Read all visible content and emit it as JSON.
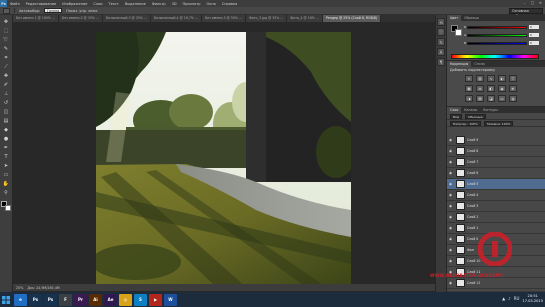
{
  "app": {
    "logo": "Ps"
  },
  "menu": [
    "Файл",
    "Редактирование",
    "Изображение",
    "Слои",
    "Текст",
    "Выделение",
    "Фильтр",
    "3D",
    "Просмотр",
    "Окно",
    "Справка"
  ],
  "window_controls": [
    "–",
    "□",
    "✕"
  ],
  "options": {
    "label_auto": "Автовыбор:",
    "auto_value": "Группа",
    "label_show": "Показ. упр. элем."
  },
  "workspace": "Основная рабочая среда",
  "doc_tabs": [
    {
      "label": "Без имени-1 @ 100% ...",
      "active": false
    },
    {
      "label": "Без имени-2 @ 33% ...",
      "active": false
    },
    {
      "label": "Безымянный-3 @ 25% ...",
      "active": false
    },
    {
      "label": "Безымянный-4 @ 16,7% ...",
      "active": false
    },
    {
      "label": "Без имени-5 @ 50% ...",
      "active": false
    },
    {
      "label": "Фото_3.jpg @ 33% ...",
      "active": false
    },
    {
      "label": "Фото_4 @ 16% ...",
      "active": false
    },
    {
      "label": "Рендер @ 25% (Слой 8, RGB/8)",
      "active": true
    }
  ],
  "tools": [
    "move-icon",
    "marquee-icon",
    "lasso-icon",
    "quick-select-icon",
    "crop-icon",
    "eyedropper-icon",
    "healing-icon",
    "brush-icon",
    "clone-stamp-icon",
    "history-brush-icon",
    "eraser-icon",
    "gradient-icon",
    "blur-icon",
    "dodge-icon",
    "pen-icon",
    "type-icon",
    "path-select-icon",
    "shape-icon",
    "hand-icon",
    "zoom-icon"
  ],
  "status": {
    "zoom": "25%",
    "doc": "Док: 24,9М/265,4М"
  },
  "panels": {
    "color_tabs": [
      "Цвет",
      "Образцы"
    ],
    "color_sliders": [
      {
        "label": "R",
        "value": "0"
      },
      {
        "label": "G",
        "value": "0"
      },
      {
        "label": "B",
        "value": "0"
      }
    ],
    "adj_tabs": [
      "Коррекция",
      "Стили"
    ],
    "adj_title": "Добавить корректировку",
    "layers_tabs": [
      "Слои",
      "Каналы",
      "Контуры"
    ],
    "kind_filter": "Вид",
    "blend_mode": "Обычные",
    "opacity": "Непрозр.: 100%",
    "fill": "Заливка: 100%",
    "layers": [
      {
        "name": "Слой 9",
        "selected": false
      },
      {
        "name": "Слой 8",
        "selected": false
      },
      {
        "name": "Слой 7",
        "selected": false
      },
      {
        "name": "Слой 6",
        "selected": false
      },
      {
        "name": "Слой 5",
        "selected": true
      },
      {
        "name": "Слой 4",
        "selected": false
      },
      {
        "name": "Слой 3",
        "selected": false
      },
      {
        "name": "Слой 2",
        "selected": false
      },
      {
        "name": "Слой 1",
        "selected": false
      },
      {
        "name": "Слой 0",
        "selected": false
      },
      {
        "name": "Фон",
        "selected": false
      },
      {
        "name": "Слой 10",
        "selected": false
      },
      {
        "name": "Слой 11",
        "selected": false
      },
      {
        "name": "Слой 12",
        "selected": false
      }
    ]
  },
  "watermark": "WWW.DECORATOR-ACADEMY",
  "taskbar": {
    "apps": [
      {
        "label": "e",
        "color": "#1e6fc4"
      },
      {
        "label": "Ps",
        "color": "#17324f"
      },
      {
        "label": "Ps",
        "color": "#17324f"
      },
      {
        "label": "F",
        "color": "#3a3f45"
      },
      {
        "label": "Pr",
        "color": "#3b1a4f"
      },
      {
        "label": "Ai",
        "color": "#5a2a00"
      },
      {
        "label": "Ae",
        "color": "#2e1a4f"
      },
      {
        "label": "◎",
        "color": "#d9a21b"
      },
      {
        "label": "S",
        "color": "#0f7fc4"
      },
      {
        "label": "▶",
        "color": "#b3261e"
      },
      {
        "label": "W",
        "color": "#1e4f9c"
      }
    ],
    "time": "20:51",
    "date": "17.03.2015",
    "lang": "RU"
  }
}
